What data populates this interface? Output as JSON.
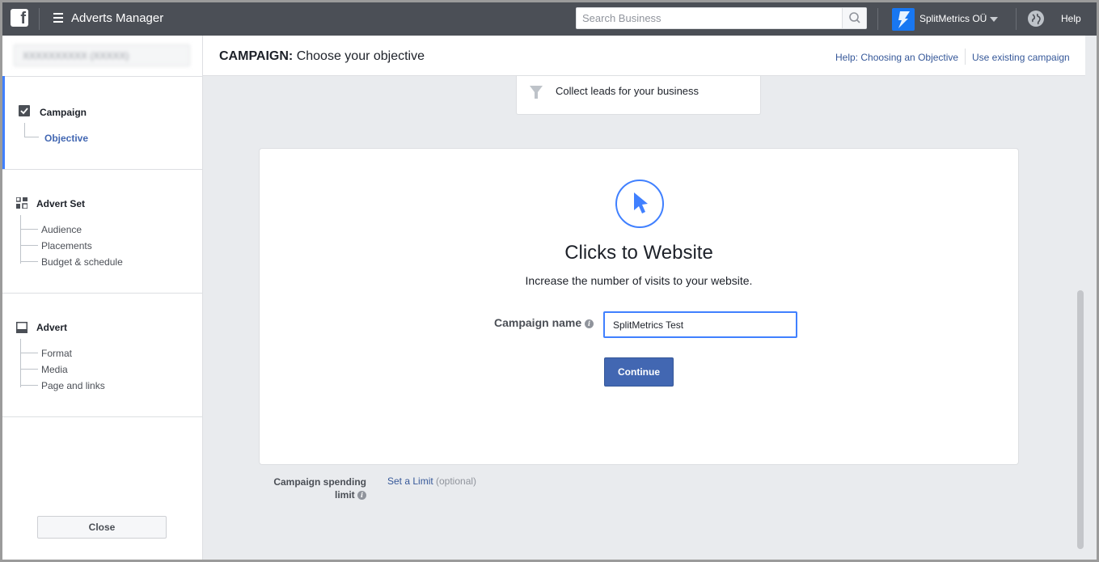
{
  "topbar": {
    "app_title": "Adverts Manager",
    "search_placeholder": "Search Business",
    "account_name": "SplitMetrics OÜ",
    "help_label": "Help"
  },
  "sidebar": {
    "account_selector": "XXXXXXXXXX (XXXXX)",
    "sections": [
      {
        "label": "Campaign",
        "icon": "checkbox-icon",
        "items": [
          "Objective"
        ]
      },
      {
        "label": "Advert Set",
        "icon": "grid-icon",
        "items": [
          "Audience",
          "Placements",
          "Budget & schedule"
        ]
      },
      {
        "label": "Advert",
        "icon": "advert-icon",
        "items": [
          "Format",
          "Media",
          "Page and links"
        ]
      }
    ],
    "active_item": "Objective",
    "close_label": "Close"
  },
  "header": {
    "title_bold": "CAMPAIGN:",
    "title_rest": " Choose your objective",
    "help_link": "Help: Choosing an Objective",
    "existing_link": "Use existing campaign"
  },
  "main": {
    "lead_option": "Collect leads for your business",
    "objective": {
      "icon": "cursor-icon",
      "title": "Clicks to Website",
      "description": "Increase the number of visits to your website.",
      "campaign_name_label": "Campaign name",
      "campaign_name_value": "SplitMetrics Test",
      "continue_label": "Continue"
    },
    "spending": {
      "label_line1": "Campaign spending",
      "label_line2": "limit",
      "link": "Set a Limit",
      "optional": "(optional)"
    }
  },
  "colors": {
    "topbar": "#4b4f56",
    "accent": "#4267b2",
    "focus": "#4080ff",
    "background": "#e9ebee"
  }
}
